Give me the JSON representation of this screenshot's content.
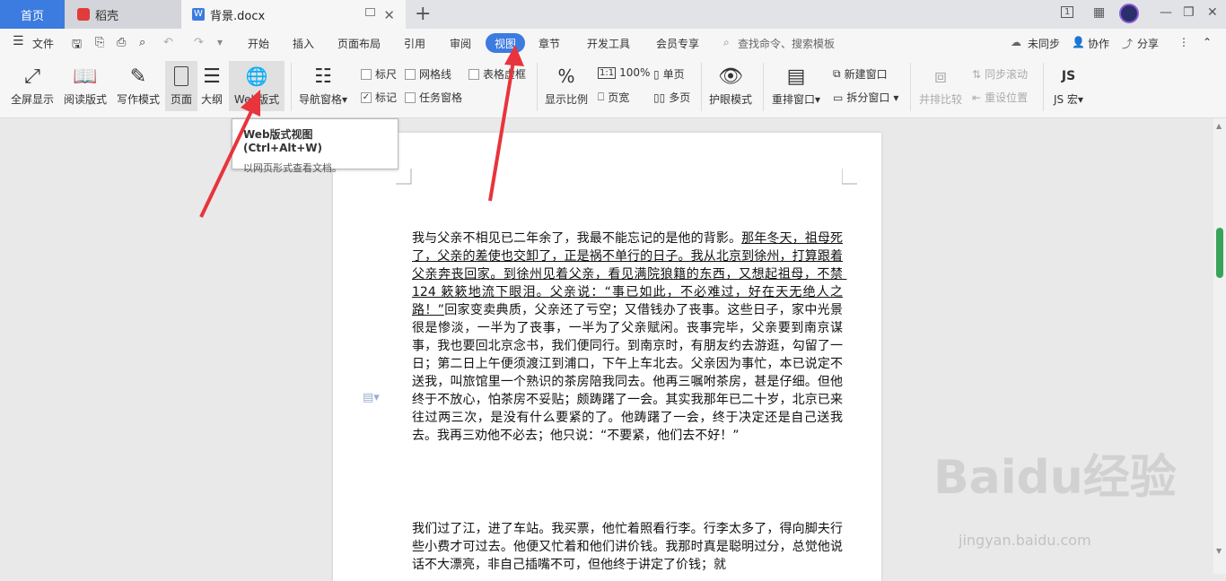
{
  "tabs": {
    "home": "首页",
    "daoke": "稻壳",
    "doc": "背景.docx",
    "page_num": "1"
  },
  "menu": {
    "file": "文件",
    "items": [
      "开始",
      "插入",
      "页面布局",
      "引用",
      "审阅",
      "视图",
      "章节",
      "开发工具",
      "会员专享"
    ],
    "search_placeholder": "查找命令、搜索模板",
    "sync": "未同步",
    "collab": "协作",
    "share": "分享"
  },
  "ribbon": {
    "fullscreen": "全屏显示",
    "read_mode": "阅读版式",
    "write_mode": "写作模式",
    "page": "页面",
    "outline": "大纲",
    "web_layout": "Web版式",
    "nav_pane": "导航窗格",
    "ruler": "标尺",
    "gridlines": "网格线",
    "table_grid": "表格虚框",
    "markup": "标记",
    "task_pane": "任务窗格",
    "zoom": "显示比例",
    "zoom_100": "100%",
    "single_page": "单页",
    "page_width": "页宽",
    "multi_page": "多页",
    "eye_care": "护眼模式",
    "rearrange": "重排窗口",
    "new_window": "新建窗口",
    "split_window": "拆分窗口",
    "compare": "并排比较",
    "sync_scroll": "同步滚动",
    "reset_pos": "重设位置",
    "macro": "JS 宏"
  },
  "tooltip": {
    "title": "Web版式视图 (Ctrl+Alt+W)",
    "desc": "以网页形式查看文档。"
  },
  "document": {
    "p1_a": "我与父亲不相见已二年余了，我最不能忘记的是他的背影。",
    "p1_u": "那年冬天，祖母死了，父亲的差使也交卸了，正是祸不单行的日子。我从北京到徐州，打算跟着父亲奔丧回家。到徐州见着父亲，看见满院狼籍的东西，又想起祖母，不禁 124 簌簌地流下眼泪。父亲说：“事已如此，不必难过，好在天无绝人之路！”",
    "p1_b": "回家变卖典质，父亲还了亏空；又借钱办了丧事。这些日子，家中光景很是惨淡，一半为了丧事，一半为了父亲赋闲。丧事完毕，父亲要到南京谋事，我也要回北京念书，我们便同行。到南京时，有朋友约去游逛，勾留了一日；第二日上午便须渡江到浦口，下午上车北去。父亲因为事忙，本已说定不送我，叫旅馆里一个熟识的茶房陪我同去。他再三嘱咐茶房，甚是仔细。但他终于不放心，怕茶房不妥贴；颇踌躇了一会。其实我那年已二十岁，北京已来往过两三次，是没有什么要紧的了。他踌躇了一会，终于决定还是自己送我去。我再三劝他不必去；他只说：“不要紧，他们去不好！”",
    "p2": "我们过了江，进了车站。我买票，他忙着照看行李。行李太多了，得向脚夫行些小费才可过去。他便又忙着和他们讲价钱。我那时真是聪明过分，总觉他说话不大漂亮，非自己插嘴不可，但他终于讲定了价钱；就"
  },
  "watermark": {
    "brand": "Baidu经验",
    "url": "jingyan.baidu.com"
  },
  "colors": {
    "accent": "#3c7bdf",
    "arrow": "#e8343c"
  }
}
